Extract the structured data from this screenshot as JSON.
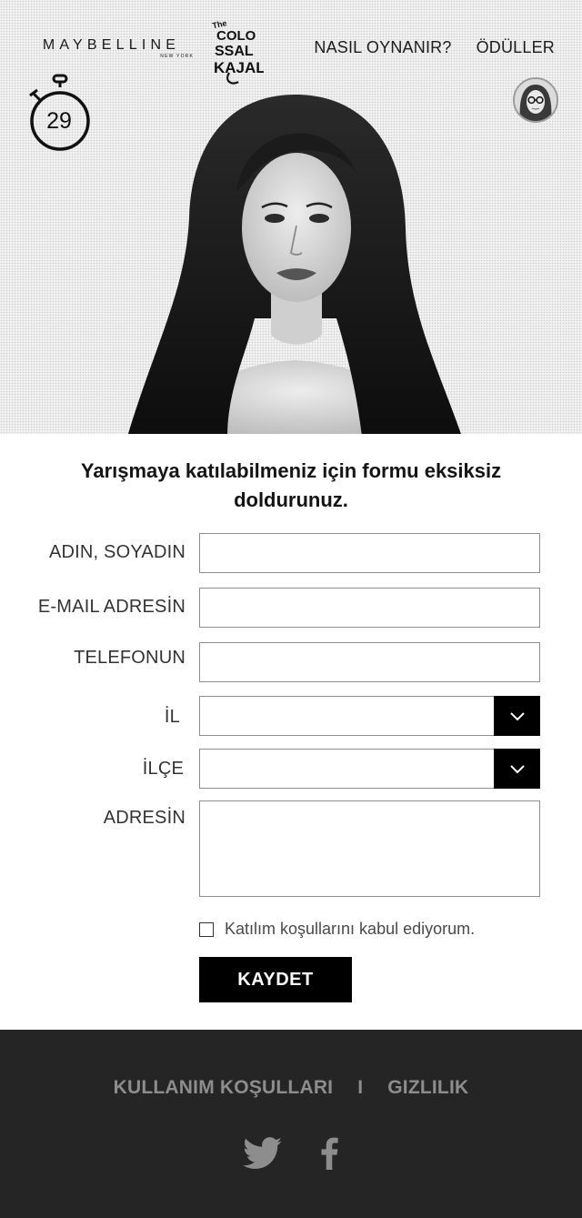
{
  "header": {
    "brand_name": "MAYBELLINE",
    "brand_sub": "NEW YORK",
    "campaign_logo": "The COLOSSAL KAJAL",
    "nav": [
      {
        "label": "NASIL OYNANIR?"
      },
      {
        "label": "ÖDÜLLER"
      }
    ]
  },
  "timer": {
    "value": "29",
    "icon": "stopwatch-icon"
  },
  "form": {
    "title": "Yarışmaya katılabilmeniz için formu eksiksiz doldurunuz.",
    "fields": {
      "name": {
        "label": "ADIN, SOYADIN",
        "value": ""
      },
      "email": {
        "label": "E-MAIL ADRESİN",
        "value": ""
      },
      "phone": {
        "label": "TELEFONUN",
        "value": ""
      },
      "city": {
        "label": "İL",
        "value": ""
      },
      "district": {
        "label": "İLÇE",
        "value": ""
      },
      "address": {
        "label": "ADRESİN",
        "value": ""
      }
    },
    "terms_label": "Katılım koşullarını kabul ediyorum.",
    "terms_checked": false,
    "submit_label": "KAYDET"
  },
  "footer": {
    "links": [
      {
        "label": "KULLANIM KOŞULLARI"
      },
      {
        "label": "GIZLILIK"
      }
    ],
    "separator": "I",
    "social": [
      "twitter-icon",
      "facebook-icon"
    ]
  },
  "colors": {
    "button_bg": "#000000",
    "footer_bg": "#252525",
    "footer_text": "#8d8d8d"
  }
}
